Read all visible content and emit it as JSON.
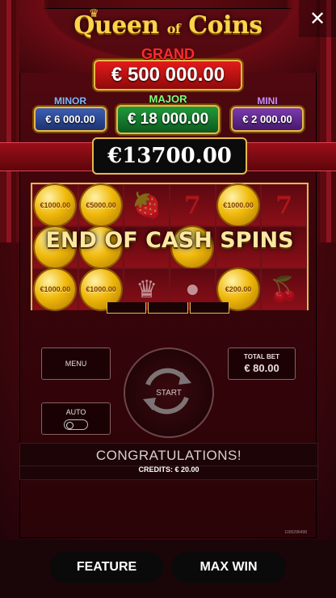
{
  "game": {
    "title_main_1": "Queen",
    "title_of": "of",
    "title_main_2": "Coins"
  },
  "jackpots": {
    "grand": {
      "label": "GRAND",
      "value": "€ 500 000.00"
    },
    "minor": {
      "label": "MINOR",
      "value": "€ 6 000.00"
    },
    "major": {
      "label": "MAJOR",
      "value": "€ 18 000.00"
    },
    "mini": {
      "label": "MINI",
      "value": "€ 2 000.00"
    }
  },
  "win_amount": "€13700.00",
  "reels": {
    "rows": [
      [
        {
          "type": "coin",
          "value": "€1000.00"
        },
        {
          "type": "coin",
          "value": "€5000.00"
        },
        {
          "type": "symbol",
          "icon": "strawberry-icon",
          "glyph": "🍓"
        },
        {
          "type": "symbol",
          "icon": "seven-icon",
          "glyph": "7"
        },
        {
          "type": "coin",
          "value": "€1000.00"
        },
        {
          "type": "symbol",
          "icon": "seven-icon",
          "glyph": "7"
        }
      ],
      [
        {
          "type": "coin",
          "value": ""
        },
        {
          "type": "coin",
          "value": ""
        },
        {
          "type": "symbol",
          "icon": "bell-icon",
          "glyph": ""
        },
        {
          "type": "coin",
          "value": ""
        },
        {
          "type": "symbol",
          "icon": "cherry-icon",
          "glyph": ""
        },
        {
          "type": "symbol",
          "icon": "orange-icon",
          "glyph": ""
        }
      ],
      [
        {
          "type": "coin",
          "value": "€1000.00"
        },
        {
          "type": "coin",
          "value": "€1000.00"
        },
        {
          "type": "symbol",
          "icon": "jester-icon",
          "glyph": "♛"
        },
        {
          "type": "symbol",
          "icon": "orange-icon",
          "glyph": "●"
        },
        {
          "type": "coin",
          "value": "€200.00"
        },
        {
          "type": "symbol",
          "icon": "cherry-icon",
          "glyph": "🍒"
        }
      ]
    ]
  },
  "banner": "END OF CASH SPINS",
  "controls": {
    "menu": "MENU",
    "auto": "AUTO",
    "total_bet_label": "TOTAL BET",
    "total_bet_value": "€ 80.00",
    "start": "START"
  },
  "message": {
    "title": "CONGRATULATIONS!",
    "credits": "CREDITS: € 20.00"
  },
  "game_id": "1000296498",
  "close_glyph": "✕",
  "buttons": {
    "feature": "FEATURE",
    "max_win": "MAX WIN"
  }
}
